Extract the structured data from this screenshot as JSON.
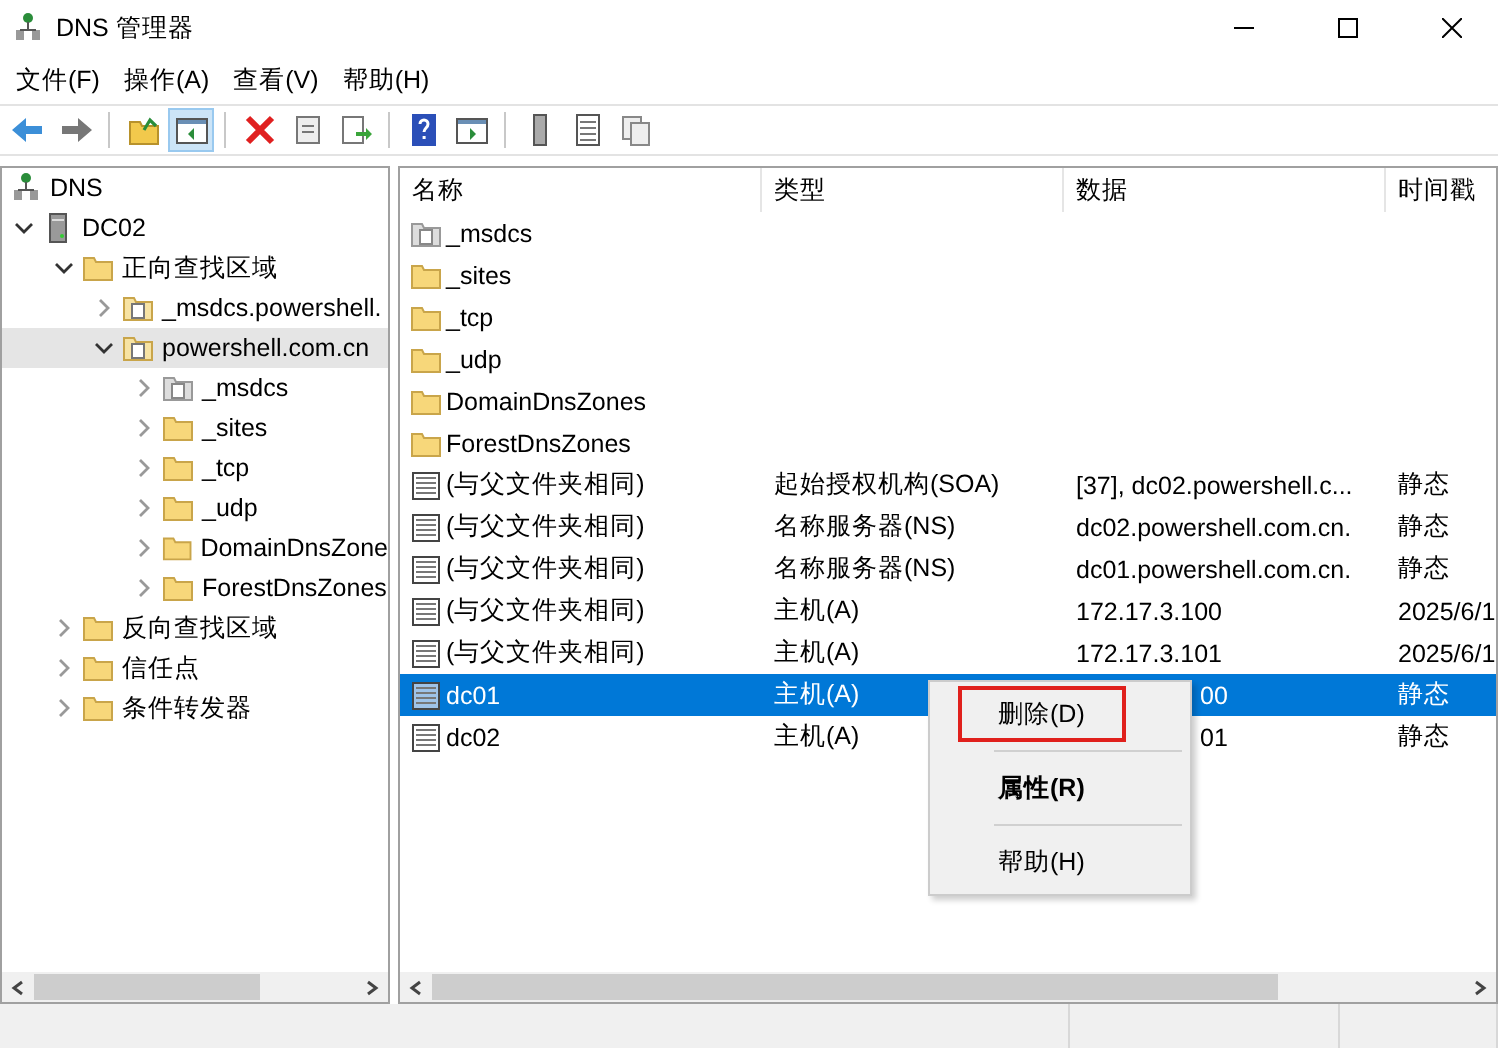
{
  "window": {
    "title": "DNS 管理器"
  },
  "menu": [
    "文件(F)",
    "操作(A)",
    "查看(V)",
    "帮助(H)"
  ],
  "toolbar": [
    {
      "kind": "back",
      "pressed": false
    },
    {
      "kind": "forward",
      "pressed": false
    },
    {
      "kind": "sep"
    },
    {
      "kind": "up",
      "pressed": false
    },
    {
      "kind": "tree",
      "pressed": true
    },
    {
      "kind": "sep"
    },
    {
      "kind": "delete",
      "pressed": false
    },
    {
      "kind": "properties",
      "pressed": false
    },
    {
      "kind": "export",
      "pressed": false
    },
    {
      "kind": "sep"
    },
    {
      "kind": "help",
      "pressed": false
    },
    {
      "kind": "pane",
      "pressed": false
    },
    {
      "kind": "sep"
    },
    {
      "kind": "server",
      "pressed": false
    },
    {
      "kind": "list",
      "pressed": false
    },
    {
      "kind": "copy",
      "pressed": false
    }
  ],
  "tree": [
    {
      "label": "DNS",
      "kind": "dns",
      "children": [
        {
          "label": "DC02",
          "kind": "server",
          "expanded": true,
          "selected": false,
          "children": [
            {
              "label": "正向查找区域",
              "kind": "folder",
              "expanded": true,
              "selected": false,
              "children": [
                {
                  "label": "_msdcs.powershell.",
                  "kind": "zone",
                  "expanded": false,
                  "selected": false
                },
                {
                  "label": "powershell.com.cn",
                  "kind": "zone",
                  "expanded": true,
                  "selected": true,
                  "children": [
                    {
                      "label": "_msdcs",
                      "kind": "delegation",
                      "expanded": false,
                      "selected": false
                    },
                    {
                      "label": "_sites",
                      "kind": "folder",
                      "expanded": false,
                      "selected": false
                    },
                    {
                      "label": "_tcp",
                      "kind": "folder",
                      "expanded": false,
                      "selected": false
                    },
                    {
                      "label": "_udp",
                      "kind": "folder",
                      "expanded": false,
                      "selected": false
                    },
                    {
                      "label": "DomainDnsZone",
                      "kind": "folder",
                      "expanded": false,
                      "selected": false
                    },
                    {
                      "label": "ForestDnsZones",
                      "kind": "folder",
                      "expanded": false,
                      "selected": false
                    }
                  ]
                }
              ]
            },
            {
              "label": "反向查找区域",
              "kind": "folder",
              "expanded": false,
              "selected": false
            },
            {
              "label": "信任点",
              "kind": "folder",
              "expanded": false,
              "selected": false
            },
            {
              "label": "条件转发器",
              "kind": "folder",
              "expanded": false,
              "selected": false
            }
          ]
        }
      ]
    }
  ],
  "table": {
    "columns": [
      "名称",
      "类型",
      "数据",
      "时间戳"
    ],
    "rows": [
      {
        "kind": "delegation",
        "name": "_msdcs",
        "selected": false
      },
      {
        "kind": "folder",
        "name": "_sites",
        "selected": false
      },
      {
        "kind": "folder",
        "name": "_tcp",
        "selected": false
      },
      {
        "kind": "folder",
        "name": "_udp",
        "selected": false
      },
      {
        "kind": "folder",
        "name": "DomainDnsZones",
        "selected": false
      },
      {
        "kind": "folder",
        "name": "ForestDnsZones",
        "selected": false
      },
      {
        "kind": "record",
        "name": "(与父文件夹相同)",
        "type": "起始授权机构(SOA)",
        "data": "[37], dc02.powershell.c...",
        "timestamp": "静态",
        "selected": false
      },
      {
        "kind": "record",
        "name": "(与父文件夹相同)",
        "type": "名称服务器(NS)",
        "data": "dc02.powershell.com.cn.",
        "timestamp": "静态",
        "selected": false
      },
      {
        "kind": "record",
        "name": "(与父文件夹相同)",
        "type": "名称服务器(NS)",
        "data": "dc01.powershell.com.cn.",
        "timestamp": "静态",
        "selected": false
      },
      {
        "kind": "record",
        "name": "(与父文件夹相同)",
        "type": "主机(A)",
        "data": "172.17.3.100",
        "timestamp": "2025/6/1",
        "selected": false
      },
      {
        "kind": "record",
        "name": "(与父文件夹相同)",
        "type": "主机(A)",
        "data": "172.17.3.101",
        "timestamp": "2025/6/1",
        "selected": false
      },
      {
        "kind": "record",
        "name": "dc01",
        "type": "主机(A)",
        "data": "00",
        "data_covered": true,
        "timestamp": "静态",
        "selected": true
      },
      {
        "kind": "record",
        "name": "dc02",
        "type": "主机(A)",
        "data": "01",
        "data_covered": true,
        "timestamp": "静态",
        "selected": false
      }
    ]
  },
  "context_menu": [
    {
      "label": "删除(D)",
      "highlighted": true,
      "bold": false
    },
    {
      "label": "属性(R)",
      "highlighted": false,
      "bold": true
    },
    {
      "label": "帮助(H)",
      "highlighted": false,
      "bold": false
    }
  ]
}
